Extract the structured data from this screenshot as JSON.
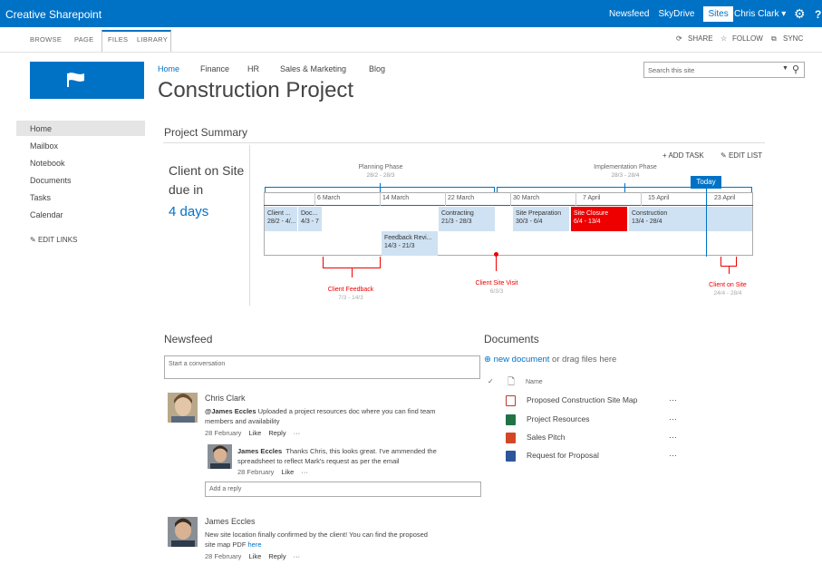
{
  "suitebar": {
    "brand": "Creative Sharepoint",
    "links": [
      "Newsfeed",
      "SkyDrive",
      "Sites"
    ],
    "user": "Chris Clark ▾",
    "help": "?"
  },
  "ribbon": {
    "tabs": [
      "BROWSE",
      "PAGE",
      "FILES",
      "LIBRARY"
    ],
    "actions": [
      "SHARE",
      "FOLLOW",
      "SYNC"
    ]
  },
  "topnav": [
    "Home",
    "Finance",
    "HR",
    "Sales & Marketing",
    "Blog"
  ],
  "page_title": "Construction Project",
  "search": {
    "placeholder": "Search this site"
  },
  "leftnav": [
    "Home",
    "Mailbox",
    "Notebook",
    "Documents",
    "Tasks",
    "Calendar"
  ],
  "edit_links": "EDIT LINKS",
  "project_summary": {
    "title": "Project Summary",
    "client_line1": "Client on Site",
    "client_line2": "due in",
    "days": "4 days",
    "add_task": "+ ADD TASK",
    "edit_list": "EDIT LIST",
    "phases": [
      {
        "name": "Planning Phase",
        "dates": "28/2 - 28/3"
      },
      {
        "name": "Implementation Phase",
        "dates": "28/3 - 28/4"
      }
    ],
    "timeline_labels": [
      "6 March",
      "14 March",
      "22 March",
      "30 March",
      "7 April",
      "15 April",
      "23 April"
    ],
    "today": "Today",
    "tasks": [
      {
        "name": "Client ...",
        "dates": "28/2 - 4/..."
      },
      {
        "name": "Doc...",
        "dates": "4/3 - 7"
      },
      {
        "name": "Contracting",
        "dates": "21/3 - 28/3"
      },
      {
        "name": "Site Preparation",
        "dates": "30/3 - 6/4"
      },
      {
        "name": "Site Closure",
        "dates": "6/4 - 13/4"
      },
      {
        "name": "Construction",
        "dates": "13/4 - 28/4"
      },
      {
        "name": "Feedback Revi...",
        "dates": "14/3 - 21/3"
      }
    ],
    "callouts": [
      {
        "name": "Client Feedback",
        "dates": "7/3 - 14/3"
      },
      {
        "name": "Client Site Visit",
        "dates": "6/3/3"
      },
      {
        "name": "Client on Site",
        "dates": "24/4 - 28/4"
      }
    ]
  },
  "newsfeed": {
    "title": "Newsfeed",
    "placeholder": "Start a conversation",
    "posts": [
      {
        "author": "Chris Clark",
        "mention": "@James Eccles",
        "text_line1": " Uploaded a project resources doc where you can find team",
        "text_line2": "members and availability",
        "date": "28 February",
        "like": "Like",
        "reply": "Reply",
        "more": "···"
      },
      {
        "author": "James Eccles",
        "text_line1": "Thanks Chris, this looks great. I've ammended the",
        "text_line2": "spreadsheet to reflect Mark's request as per the email",
        "date": "28 February",
        "like": "Like",
        "more": "···"
      },
      {
        "author": "James Eccles",
        "text_line1": "New site location finally confirmed by the client! You can find the proposed",
        "text_line2": "site map PDF ",
        "link": "here",
        "date": "28 February",
        "like": "Like",
        "reply": "Reply",
        "more": "···"
      }
    ],
    "reply_placeholder": "Add a reply"
  },
  "documents": {
    "title": "Documents",
    "new_document": "new document",
    "new_document_rest": " or drag files here",
    "name_header": "Name",
    "items": [
      {
        "name": "Proposed Construction Site Map",
        "color": "#c0392b"
      },
      {
        "name": "Project Resources",
        "color": "#217346"
      },
      {
        "name": "Sales Pitch",
        "color": "#d24726"
      },
      {
        "name": "Request for Proposal",
        "color": "#2b579a"
      }
    ],
    "ellipsis": "···"
  },
  "colors": {
    "accent": "#0072c6",
    "alert": "#e00000",
    "task": "#cfe2f3"
  }
}
